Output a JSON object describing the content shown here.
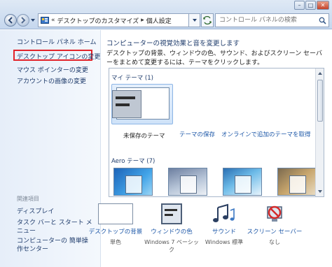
{
  "address_bar": {
    "path_separator": "«",
    "crumbs": [
      "デスクトップのカスタマイズ",
      "個人設定"
    ],
    "crumb_separator": "▸"
  },
  "search": {
    "placeholder": "コントロール パネルの検索"
  },
  "left_nav": {
    "home": "コントロール パネル ホーム",
    "links": [
      "デスクトップ アイコンの変更",
      "マウス ポインターの変更",
      "アカウントの画像の変更"
    ],
    "highlighted_index": 0,
    "related_title": "関連項目",
    "related_links": [
      "ディスプレイ",
      "タスク バーと スタート メニュー",
      "コンピューターの 簡単操作センター"
    ]
  },
  "main": {
    "heading": "コンピューターの視覚効果と音を変更します",
    "description": "デスクトップの背景、ウィンドウの色、サウンド、およびスクリーン セーバーをまとめて変更するには、テーマをクリックします。",
    "my_themes_title": "マイ テーマ (1)",
    "unsaved_theme_label": "未保存のテーマ",
    "save_theme_link": "テーマの保存",
    "online_themes_link": "オンラインで追加のテーマを取得",
    "aero_themes_title": "Aero テーマ (7)"
  },
  "bottom": [
    {
      "link": "デスクトップの背景",
      "sub": "単色",
      "icon": "desktop-background-icon"
    },
    {
      "link": "ウィンドウの色",
      "sub": "Windows 7 ベーシック",
      "icon": "window-color-icon"
    },
    {
      "link": "サウンド",
      "sub": "Windows 標準",
      "icon": "sound-icon"
    },
    {
      "link": "スクリーン セーバー",
      "sub": "なし",
      "icon": "screensaver-icon"
    }
  ],
  "colors": {
    "link": "#1e58a8",
    "highlight_border": "#e2232a",
    "nav_bg": "#e6eef9"
  }
}
